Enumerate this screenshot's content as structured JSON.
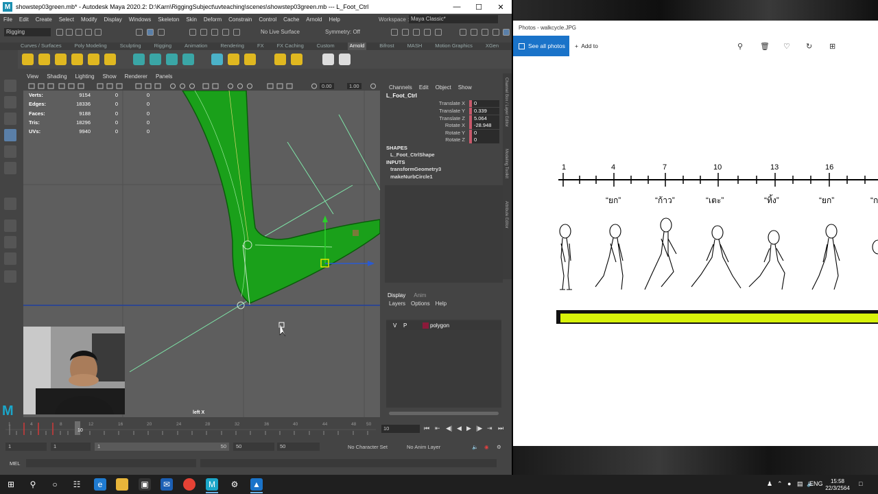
{
  "maya": {
    "title": "showstep03green.mb* - Autodesk Maya 2020.2: D:\\Karn\\RiggingSubject\\uvteaching\\scenes\\showstep03green.mb  ---  L_Foot_Ctrl",
    "menus": [
      "File",
      "Edit",
      "Create",
      "Select",
      "Modify",
      "Display",
      "Windows",
      "Skeleton",
      "Skin",
      "Deform",
      "Constrain",
      "Control",
      "Cache",
      "Arnold",
      "Help"
    ],
    "workspace_label": "Workspace :",
    "workspace_value": "Maya Classic*",
    "mode": "Rigging",
    "live_surface": "No Live Surface",
    "symmetry": "Symmetry: Off",
    "shelf_tabs": [
      "Curves / Surfaces",
      "Poly Modeling",
      "Sculpting",
      "Rigging",
      "Animation",
      "Rendering",
      "FX",
      "FX Caching",
      "Custom",
      "Arnold",
      "Bifrost",
      "MASH",
      "Motion Graphics",
      "XGen"
    ],
    "active_shelf": "Arnold",
    "panel_menus": [
      "View",
      "Shading",
      "Lighting",
      "Show",
      "Renderer",
      "Panels"
    ],
    "panel_values": [
      "0.00",
      "1.00"
    ],
    "hud": [
      {
        "k": "Verts:",
        "v": "9154",
        "v2": "0",
        "v3": "0"
      },
      {
        "k": "Edges:",
        "v": "18336",
        "v2": "0",
        "v3": "0"
      },
      {
        "k": "Faces:",
        "v": "9188",
        "v2": "0",
        "v3": "0"
      },
      {
        "k": "Tris:",
        "v": "18296",
        "v2": "0",
        "v3": "0"
      },
      {
        "k": "UVs:",
        "v": "9940",
        "v2": "0",
        "v3": "0"
      }
    ],
    "camera_label": "left X",
    "channel_box": {
      "menus": [
        "Channels",
        "Edit",
        "Object",
        "Show"
      ],
      "object": "L_Foot_Ctrl",
      "attrs": [
        {
          "label": "Translate X",
          "value": "0"
        },
        {
          "label": "Translate Y",
          "value": "0.339"
        },
        {
          "label": "Translate Z",
          "value": "5.064"
        },
        {
          "label": "Rotate X",
          "value": "-28.948"
        },
        {
          "label": "Rotate Y",
          "value": "0"
        },
        {
          "label": "Rotate Z",
          "value": "0"
        }
      ],
      "shapes_header": "SHAPES",
      "shape": "L_Foot_CtrlShape",
      "inputs_header": "INPUTS",
      "inputs": [
        "transformGeometry3",
        "makeNurbCircle1"
      ]
    },
    "side_tabs": [
      "Channel Box / Layer Editor",
      "Modeling Toolkit",
      "Attribute Editor"
    ],
    "layers": {
      "tabs": [
        "Display",
        "Anim"
      ],
      "menus": [
        "Layers",
        "Options",
        "Help"
      ],
      "row": {
        "v": "V",
        "p": "P",
        "name": "polygon"
      }
    },
    "timeline_ticks": [
      "1",
      "4",
      "8",
      "12",
      "16",
      "20",
      "24",
      "28",
      "32",
      "36",
      "40",
      "44",
      "48",
      "50"
    ],
    "current_frame": "10",
    "current_frame_field": "10",
    "range": {
      "start": "1",
      "anim_start": "1",
      "range_start": "1",
      "range_end": "50",
      "anim_end": "50",
      "end": "50"
    },
    "character_set": "No Character Set",
    "anim_layer": "No Anim Layer",
    "mel_label": "MEL"
  },
  "photos": {
    "title": "Photos - walkcycle.JPG",
    "see_all": "See all photos",
    "add_to": "Add to",
    "frame_numbers": [
      "1",
      "4",
      "7",
      "10",
      "13",
      "16"
    ],
    "thai_labels": [
      "“ยก”",
      "“ก้าว”",
      "“เตะ”",
      "“ทิ้ง”",
      "“ยก”",
      "“ก"
    ]
  },
  "taskbar": {
    "lang": "ENG",
    "time": "15:58",
    "date": "22/3/2564"
  },
  "colors": {
    "maya_bg": "#444444",
    "viewport_bg": "#5e5e5e",
    "mesh_green": "#1aa01a",
    "photos_blue": "#1a73c9",
    "ground_yellow": "#d7f20a",
    "attr_key": "#c8586a"
  }
}
